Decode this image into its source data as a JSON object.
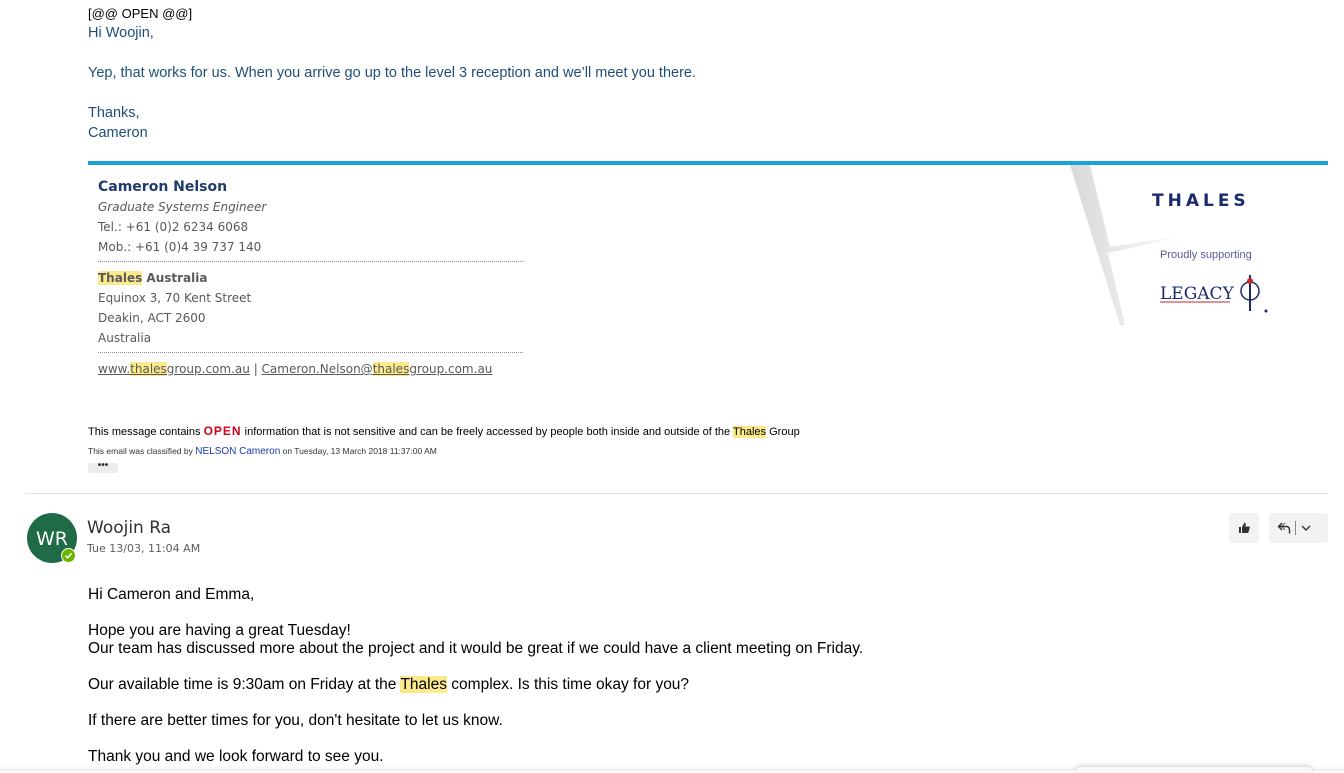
{
  "email1": {
    "classification": "[@@ OPEN @@]",
    "greeting": "Hi Woojin,",
    "line1": "Yep, that works for us. When you arrive go up to the level 3 reception and we’ll meet you there.",
    "thanks": "Thanks,",
    "signoff": "Cameron",
    "signature": {
      "name": "Cameron Nelson",
      "title": "Graduate Systems Engineer",
      "tel": "Tel.: +61 (0)2 6234 6068",
      "mob": "Mob.: +61 (0)4 39 737 140",
      "company_hl": "Thales",
      "company_rest": " Australia",
      "addr1": "Equinox 3, 70 Kent Street",
      "addr2": "Deakin, ACT 2600",
      "addr3": "Australia",
      "web_pre": "www.",
      "web_hl": "thales",
      "web_post": "group.com.au",
      "link_sep": " | ",
      "email_pre": "Cameron.Nelson@",
      "email_hl": "thales",
      "email_post": "group.com.au",
      "brand": "THALES",
      "proudly": "Proudly supporting",
      "legacy": "LEGACY"
    },
    "disclaimer_pre": "This message contains ",
    "disclaimer_open": "OPEN",
    "disclaimer_mid": " information that is not sensitive and can be freely accessed by people both inside and outside of the ",
    "disclaimer_hl": "Thales",
    "disclaimer_post": " Group",
    "classified_pre": "This email was classified by ",
    "classified_name": "NELSON Cameron",
    "classified_post": " on Tuesday, 13 March 2018 11:37:00 AM",
    "ellipsis": "•••"
  },
  "email2": {
    "avatar_initials": "WR",
    "sender": "Woojin Ra",
    "date": "Tue 13/03, 11:04 AM",
    "greeting": "Hi Cameron and Emma,",
    "line1": "Hope you are having a great Tuesday!",
    "line2": "Our team has discussed more about the project and it would be great if we could have a client meeting on Friday.",
    "line3_pre": "Our available time is 9:30am on Friday at the ",
    "line3_hl": "Thales",
    "line3_post": " complex. Is this time okay for you?",
    "line4": "If there are better times for you, don't hesitate to let us know.",
    "line5": "Thank you and we look forward to see you."
  },
  "colors": {
    "accent_bar": "#1aa4d6",
    "highlight": "#fce98b",
    "avatar_bg": "#1e6b45",
    "presence": "#6bb700",
    "open_red": "#d0021b"
  }
}
